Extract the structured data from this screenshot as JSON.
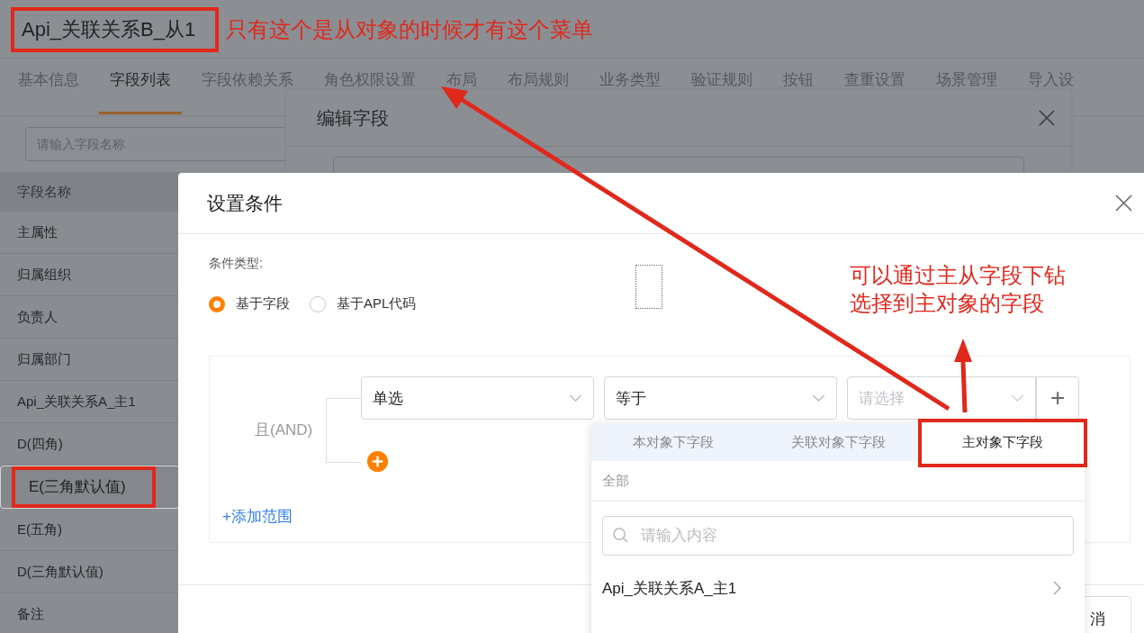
{
  "title": "Api_关联关系B_从1",
  "tabs": [
    {
      "label": "基本信息",
      "selected": false
    },
    {
      "label": "字段列表",
      "selected": true
    },
    {
      "label": "字段依赖关系",
      "selected": false
    },
    {
      "label": "角色权限设置",
      "selected": false
    },
    {
      "label": "布局",
      "selected": false
    },
    {
      "label": "布局规则",
      "selected": false
    },
    {
      "label": "业务类型",
      "selected": false
    },
    {
      "label": "验证规则",
      "selected": false
    },
    {
      "label": "按钮",
      "selected": false
    },
    {
      "label": "查重设置",
      "selected": false
    },
    {
      "label": "场景管理",
      "selected": false
    },
    {
      "label": "导入设",
      "selected": false
    }
  ],
  "field_search": {
    "placeholder": "请输入字段名称"
  },
  "field_table": {
    "column": "字段名称",
    "rows": [
      {
        "name": "主属性",
        "selected": false
      },
      {
        "name": "归属组织",
        "selected": false
      },
      {
        "name": "负责人",
        "selected": false
      },
      {
        "name": "归属部门",
        "selected": false
      },
      {
        "name": "Api_关联关系A_主1",
        "selected": false
      },
      {
        "name": "D(四角)",
        "selected": false
      },
      {
        "name": "E(三角默认值)",
        "selected": true
      },
      {
        "name": "E(五角)",
        "selected": false
      },
      {
        "name": "D(三角默认值)",
        "selected": false
      },
      {
        "name": "备注",
        "selected": false
      }
    ]
  },
  "edit_dialog": {
    "title": "编辑字段"
  },
  "condition_dialog": {
    "title": "设置条件",
    "type_label": "条件类型:",
    "types": [
      {
        "label": "基于字段",
        "selected": true
      },
      {
        "label": "基于APL代码",
        "selected": false
      }
    ],
    "logic": "且(AND)",
    "condition": {
      "field": "单选",
      "operator": "等于",
      "value_placeholder": "请选择",
      "add_value": "+"
    },
    "add_scope": "+添加范围",
    "footer_button": "消"
  },
  "dropdown": {
    "tabs": [
      {
        "label": "本对象下字段",
        "selected": false
      },
      {
        "label": "关联对象下字段",
        "selected": false
      },
      {
        "label": "主对象下字段",
        "selected": true
      }
    ],
    "category": "全部",
    "search_placeholder": "请输入内容",
    "items": [
      {
        "label": "Api_关联关系A_主1"
      }
    ]
  },
  "annotations": {
    "title_note": "只有这个是从对象的时候才有这个菜单",
    "drill_note": [
      "可以通过主从字段下钻",
      "选择到主对象的字段"
    ]
  }
}
